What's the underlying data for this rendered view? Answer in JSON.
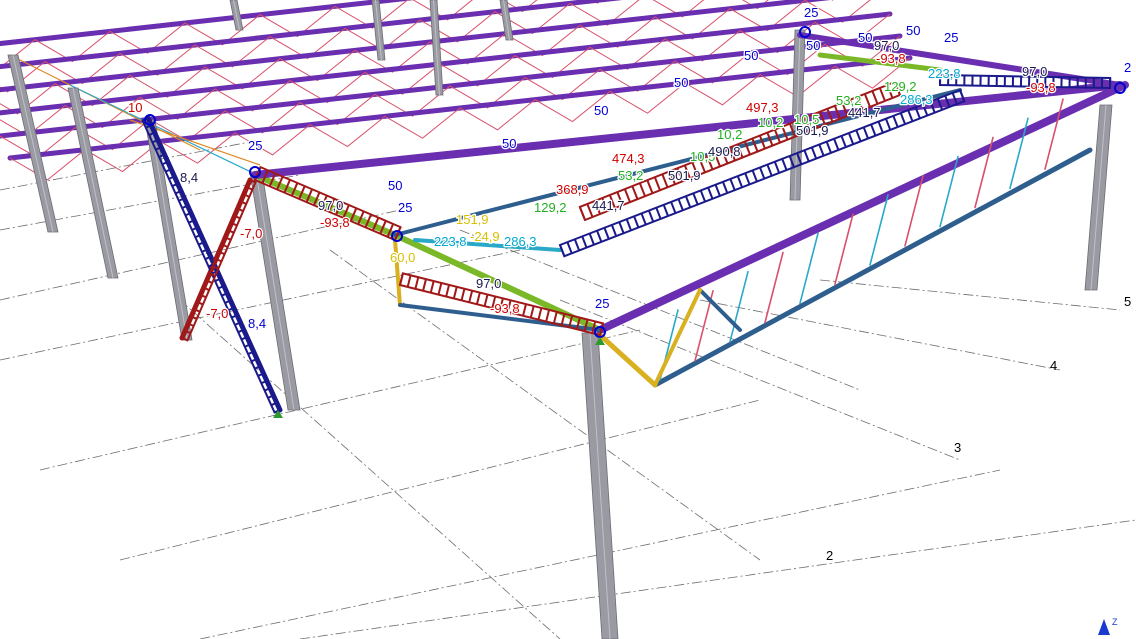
{
  "colors": {
    "grid": "#6e6e6e",
    "column": "#9a9aa2",
    "column_edge": "#6c6c74",
    "rafter": "#6a2fb0",
    "purlin": "#3a2aa0",
    "blue_load": "#1a1a8c",
    "red_load": "#a01818",
    "green_member": "#7ab828",
    "yellow_member": "#d8b020",
    "cyan_member": "#2aa8c8",
    "steel_blue": "#2e5e8e",
    "pink_brace": "#d8506a",
    "orange_brace": "#e08820",
    "label_blue": "#0000d0",
    "label_red": "#d00000",
    "label_green": "#20b020",
    "label_cyan": "#00a8d0",
    "label_yellow": "#d8c000",
    "label_black": "#1a1a50"
  },
  "grid_axes": [
    "2",
    "3",
    "4",
    "5"
  ],
  "axis_indicator": {
    "label": "Z"
  },
  "load_labels": [
    {
      "text": "10",
      "color": "red"
    },
    {
      "text": "25",
      "color": "blue"
    },
    {
      "text": "8,4",
      "color": "black"
    },
    {
      "text": "-7,0",
      "color": "red"
    },
    {
      "text": "-7,0",
      "color": "red"
    },
    {
      "text": "8,4",
      "color": "blue"
    },
    {
      "text": "97,0",
      "color": "black"
    },
    {
      "text": "-93,8",
      "color": "red"
    },
    {
      "text": "50",
      "color": "blue"
    },
    {
      "text": "25",
      "color": "blue"
    },
    {
      "text": "60,0",
      "color": "yellow"
    },
    {
      "text": "151,9",
      "color": "yellow"
    },
    {
      "text": "223,8",
      "color": "cyan"
    },
    {
      "text": "-24,9",
      "color": "yellow"
    },
    {
      "text": "286,3",
      "color": "cyan"
    },
    {
      "text": "129,2",
      "color": "green"
    },
    {
      "text": "50",
      "color": "blue"
    },
    {
      "text": "368,9",
      "color": "red"
    },
    {
      "text": "441,7",
      "color": "black"
    },
    {
      "text": "50",
      "color": "blue"
    },
    {
      "text": "474,3",
      "color": "red"
    },
    {
      "text": "53,2",
      "color": "green"
    },
    {
      "text": "10,5",
      "color": "green"
    },
    {
      "text": "501,9",
      "color": "black"
    },
    {
      "text": "97,0",
      "color": "black"
    },
    {
      "text": "-93,8",
      "color": "red"
    },
    {
      "text": "25",
      "color": "blue"
    },
    {
      "text": "50",
      "color": "blue"
    },
    {
      "text": "497,3",
      "color": "red"
    },
    {
      "text": "10,2",
      "color": "green"
    },
    {
      "text": "490,8",
      "color": "black"
    },
    {
      "text": "10,2",
      "color": "green"
    },
    {
      "text": "10,5",
      "color": "green"
    },
    {
      "text": "501,9",
      "color": "black"
    },
    {
      "text": "50",
      "color": "blue"
    },
    {
      "text": "53,2",
      "color": "green"
    },
    {
      "text": "441,7",
      "color": "black"
    },
    {
      "text": "25",
      "color": "blue"
    },
    {
      "text": "50",
      "color": "blue"
    },
    {
      "text": "50",
      "color": "blue"
    },
    {
      "text": "97,0",
      "color": "black"
    },
    {
      "text": "-93,8",
      "color": "red"
    },
    {
      "text": "50",
      "color": "blue"
    },
    {
      "text": "25",
      "color": "blue"
    },
    {
      "text": "129,2",
      "color": "green"
    },
    {
      "text": "223,8",
      "color": "cyan"
    },
    {
      "text": "286,3",
      "color": "cyan"
    },
    {
      "text": "97,0",
      "color": "black"
    },
    {
      "text": "-93,8",
      "color": "red"
    },
    {
      "text": "2",
      "color": "blue"
    }
  ]
}
